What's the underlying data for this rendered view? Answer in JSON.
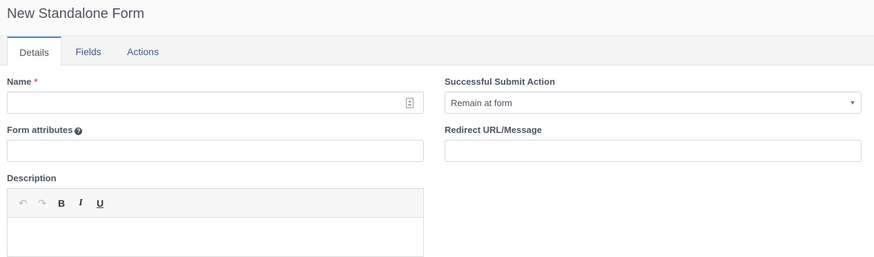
{
  "page": {
    "title": "New Standalone Form"
  },
  "tabs": [
    {
      "label": "Details",
      "active": true
    },
    {
      "label": "Fields",
      "active": false
    },
    {
      "label": "Actions",
      "active": false
    }
  ],
  "form": {
    "name": {
      "label": "Name",
      "required_marker": "*",
      "value": ""
    },
    "form_attributes": {
      "label": "Form attributes",
      "help_icon": "question-circle-icon",
      "value": ""
    },
    "description": {
      "label": "Description"
    },
    "successful_submit_action": {
      "label": "Successful Submit Action",
      "selected": "Remain at form"
    },
    "redirect_url": {
      "label": "Redirect URL/Message",
      "value": ""
    }
  },
  "editor_toolbar": {
    "undo_icon": "↶",
    "redo_icon": "↷",
    "bold": "B",
    "italic": "I",
    "underline": "U"
  },
  "colors": {
    "accent": "#3f7fce",
    "link": "#3f5a99",
    "required": "#e05e4b"
  }
}
